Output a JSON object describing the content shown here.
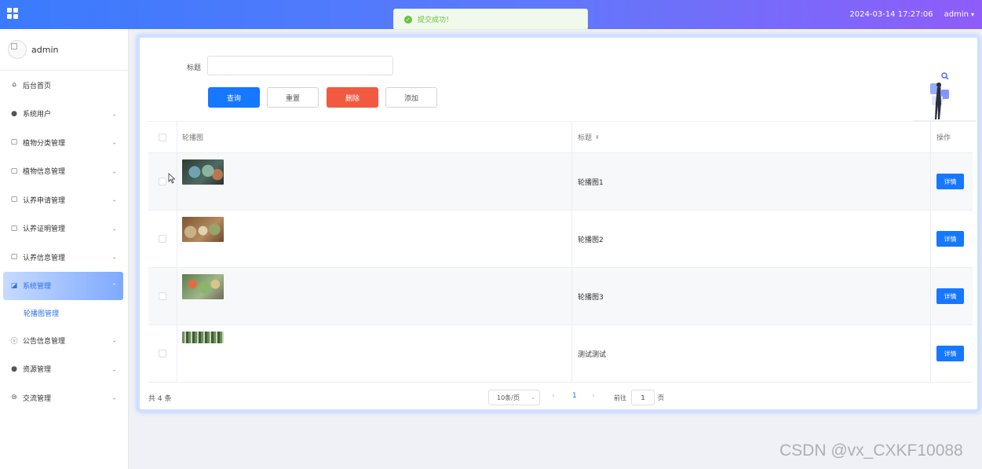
{
  "header": {
    "datetime": "2024-03-14 17:27:06",
    "user": "admin",
    "menu_icon": "grid-icon",
    "gradient": [
      "#3a7bfd",
      "#8f5cf9"
    ]
  },
  "toast": {
    "message": "提交成功！",
    "type": "success",
    "color": "#67c23a"
  },
  "sidebar": {
    "user": "admin",
    "items": [
      {
        "label": "后台首页",
        "icon": "home-icon"
      },
      {
        "label": "系统用户",
        "icon": "user-icon"
      },
      {
        "label": "植物分类管理",
        "icon": "folder-icon"
      },
      {
        "label": "植物信息管理",
        "icon": "folder-icon"
      },
      {
        "label": "认养申请管理",
        "icon": "folder-icon"
      },
      {
        "label": "认养证明管理",
        "icon": "folder-icon"
      },
      {
        "label": "认养信息管理",
        "icon": "folder-icon"
      },
      {
        "label": "系统管理",
        "icon": "chart-icon",
        "active": true
      },
      {
        "label": "公告信息管理",
        "icon": "info-icon"
      },
      {
        "label": "资源管理",
        "icon": "location-icon"
      },
      {
        "label": "交流管理",
        "icon": "chat-icon"
      }
    ],
    "submenu": {
      "label": "轮播图管理"
    },
    "active_color": "#2f6fe7"
  },
  "search": {
    "label": "标题",
    "value": "",
    "buttons": {
      "query": "查询",
      "reset": "重置",
      "delete": "删除",
      "add": "添加"
    }
  },
  "table": {
    "columns": {
      "image": "轮播图",
      "title": "标题",
      "operation": "操作"
    },
    "rows": [
      {
        "title": "轮播图1",
        "action": "详情"
      },
      {
        "title": "轮播图2",
        "action": "详情"
      },
      {
        "title": "轮播图3",
        "action": "详情"
      },
      {
        "title": "测试测试",
        "action": "详情"
      }
    ]
  },
  "pagination": {
    "total": "共 4 条",
    "page_size": "10条/页",
    "current_page": "1",
    "jump_label": "前往",
    "jump_value": "1",
    "jump_suffix": "页"
  },
  "watermark": "CSDN @vx_CXKF10088"
}
